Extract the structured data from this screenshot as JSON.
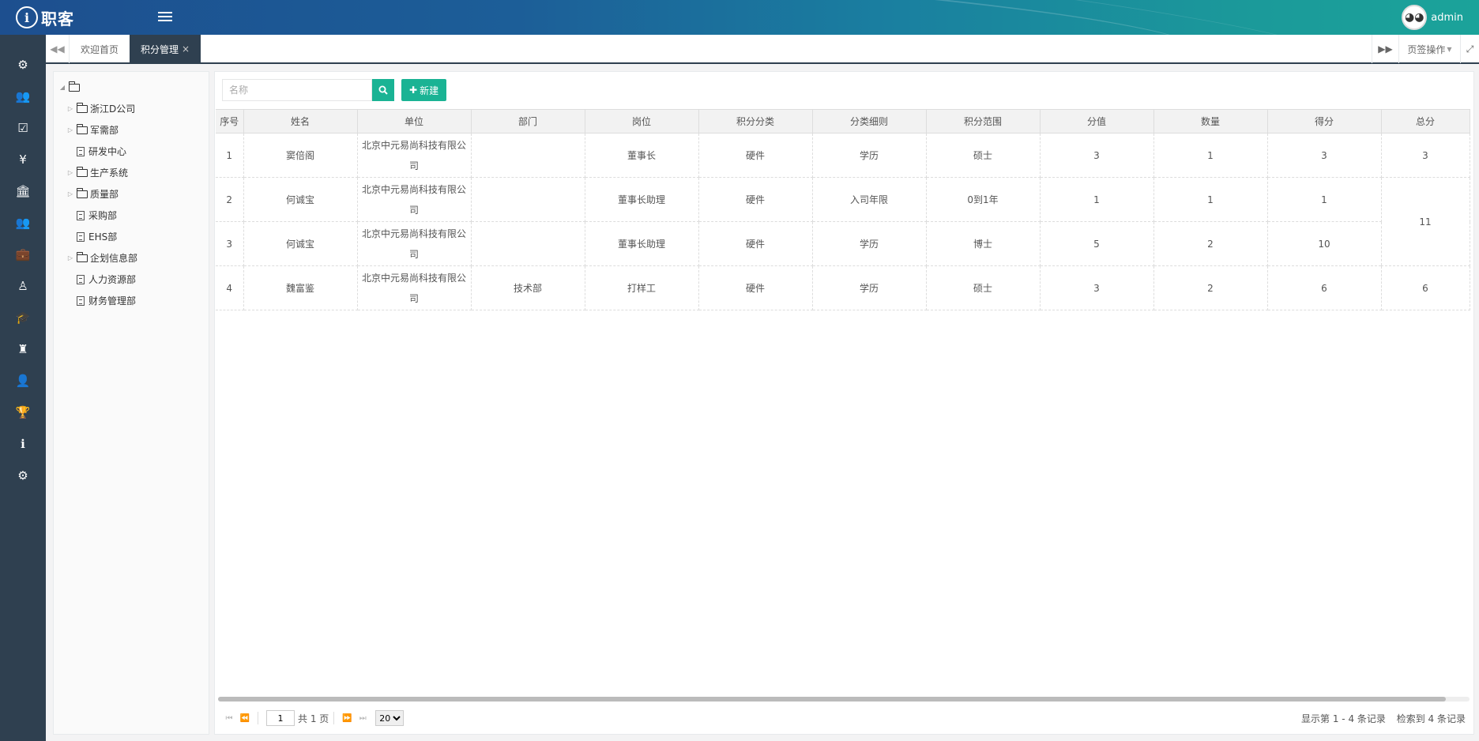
{
  "header": {
    "logo_mark": "i",
    "logo_text": "职客",
    "username": "admin"
  },
  "sidebar_icons": [
    "cubes-icon",
    "users-icon",
    "check-square-icon",
    "yen-icon",
    "bank-icon",
    "group-icon",
    "briefcase-icon",
    "user-md-icon",
    "graduation-cap-icon",
    "tie-icon",
    "user-icon",
    "trophy-icon",
    "info-icon",
    "cogs-icon"
  ],
  "tabstrip": {
    "tabs": [
      {
        "label": "欢迎首页"
      },
      {
        "label": "积分管理"
      }
    ],
    "close_label": "×",
    "page_ops_label": "页签操作"
  },
  "tree": {
    "items": [
      {
        "label": "浙江D公司",
        "type": "folder"
      },
      {
        "label": "军需部",
        "type": "folder"
      },
      {
        "label": "研发中心",
        "type": "doc"
      },
      {
        "label": "生产系统",
        "type": "folder"
      },
      {
        "label": "质量部",
        "type": "folder"
      },
      {
        "label": "采购部",
        "type": "doc"
      },
      {
        "label": "EHS部",
        "type": "doc"
      },
      {
        "label": "企划信息部",
        "type": "folder"
      },
      {
        "label": "人力资源部",
        "type": "doc"
      },
      {
        "label": "财务管理部",
        "type": "doc"
      }
    ]
  },
  "toolbar": {
    "search_placeholder": "名称",
    "new_label": "新建"
  },
  "table": {
    "columns": [
      "序号",
      "姓名",
      "单位",
      "部门",
      "岗位",
      "积分分类",
      "分类细则",
      "积分范围",
      "分值",
      "数量",
      "得分",
      "总分"
    ],
    "rows": [
      [
        "1",
        "窦倍阁",
        "北京中元易尚科技有限公司",
        "",
        "董事长",
        "硬件",
        "学历",
        "硕士",
        "3",
        "1",
        "3",
        "3"
      ],
      [
        "2",
        "何诚宝",
        "北京中元易尚科技有限公司",
        "",
        "董事长助理",
        "硬件",
        "入司年限",
        "0到1年",
        "1",
        "1",
        "1",
        ""
      ],
      [
        "3",
        "何诚宝",
        "北京中元易尚科技有限公司",
        "",
        "董事长助理",
        "硬件",
        "学历",
        "博士",
        "5",
        "2",
        "10",
        ""
      ],
      [
        "4",
        "魏富鉴",
        "北京中元易尚科技有限公司",
        "技术部",
        "打样工",
        "硬件",
        "学历",
        "硕士",
        "3",
        "2",
        "6",
        "6"
      ]
    ],
    "merged_total": "11"
  },
  "pager": {
    "page": "1",
    "total_pages_label": "共 1 页",
    "page_size": "20",
    "display_info": "显示第 1 - 4 条记录",
    "found_info": "检索到 4 条记录"
  }
}
